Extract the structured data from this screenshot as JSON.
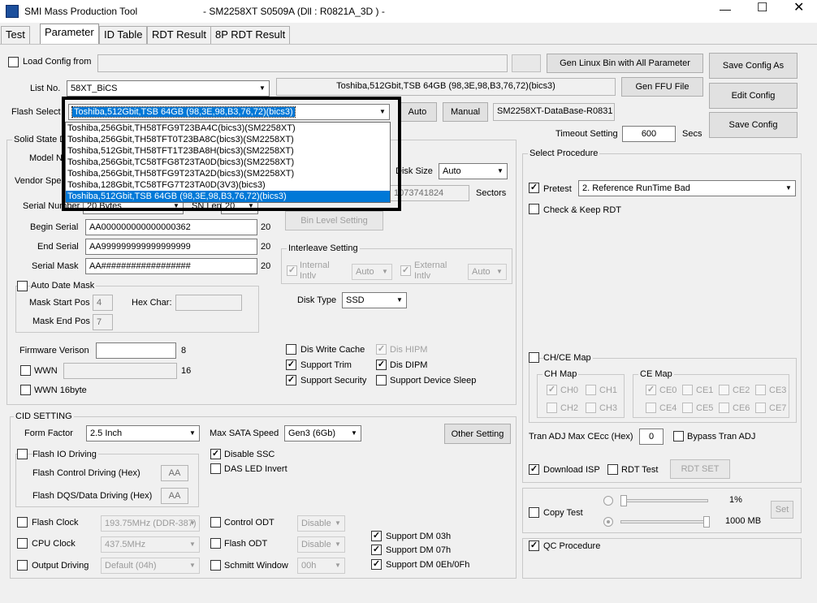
{
  "window": {
    "title": "SMI Mass Production Tool",
    "info": "- SM2258XT   S0509A     (Dll : R0821A_3D ) -"
  },
  "tabs": [
    "Test",
    "Parameter",
    "ID Table",
    "RDT Result",
    "8P RDT Result"
  ],
  "load_config": {
    "label": "Load Config from",
    "browse": "...",
    "value": ""
  },
  "buttons": {
    "gen_linux": "Gen Linux Bin with All Parameter",
    "save_config_as": "Save Config As",
    "gen_ffu": "Gen FFU File",
    "edit_config": "Edit Config",
    "save_config": "Save Config",
    "auto": "Auto",
    "manual": "Manual",
    "bin_level": "Bin Level Setting",
    "other_setting": "Other Setting",
    "rdt_set": "RDT SET",
    "set": "Set"
  },
  "list_no": {
    "label": "List No.",
    "value": "58XT_BiCS",
    "flash_desc": "Toshiba,512Gbit,TSB 64GB (98,3E,98,B3,76,72)(bics3)"
  },
  "flash_select": {
    "label": "Flash Select",
    "value": "Toshiba,512Gbit,TSB 64GB (98,3E,98,B3,76,72)(bics3)",
    "database": "SM2258XT-DataBase-R0831"
  },
  "dropdown_items": [
    "Toshiba,256Gbit,TH58TFG9T23BA4C(bics3)(SM2258XT)",
    "Toshiba,256Gbit,TH58TFT0T23BA8C(bics3)(SM2258XT)",
    "Toshiba,512Gbit,TH58TFT1T23BA8H(bics3)(SM2258XT)",
    "Toshiba,256Gbit,TC58TFG8T23TA0D(bics3)(SM2258XT)",
    "Toshiba,256Gbit,TH58TFG9T23TA2D(bics3)(SM2258XT)",
    "Toshiba,128Gbit,TC58TFG7T23TA0D(3V3)(bics3)",
    "Toshiba,512Gbit,TSB 64GB (98,3E,98,B3,76,72)(bics3)"
  ],
  "timeout": {
    "label": "Timeout Setting",
    "value": "600",
    "unit": "Secs"
  },
  "ssd": {
    "group": "Solid State D",
    "model_label": "Model Na",
    "vendor_label": "Vendor Spec",
    "serial_number_label": "Serial Number",
    "serial_number_value": "20 Bytes",
    "sn_len_label": "SN Len",
    "sn_len_value": "20",
    "disk_size_label": "Disk Size",
    "disk_size_value": "Auto",
    "sectors_value": "1073741824",
    "sectors_label": "Sectors",
    "begin_serial_label": "Begin Serial",
    "begin_serial": "AA000000000000000362",
    "begin_len": "20",
    "end_serial_label": "End Serial",
    "end_serial": "AA999999999999999999",
    "end_len": "20",
    "serial_mask_label": "Serial Mask",
    "serial_mask": "AA##################",
    "mask_len": "20",
    "auto_date_mask": "Auto Date Mask",
    "mask_start_label": "Mask Start Pos",
    "mask_start": "4",
    "hex_char_label": "Hex Char:",
    "mask_end_label": "Mask End Pos",
    "mask_end": "7",
    "interleave": "Interleave Setting",
    "internal_intlv": "Internal Intlv",
    "external_intlv": "External Intlv",
    "auto": "Auto",
    "disk_type_label": "Disk Type",
    "disk_type": "SSD",
    "fw_label": "Firmware Verison",
    "fw_len": "8",
    "wwn": "WWN",
    "wwn_len": "16",
    "wwn16": "WWN 16byte",
    "dis_write_cache": "Dis Write Cache",
    "dis_hipm": "Dis HIPM",
    "support_trim": "Support Trim",
    "dis_dipm": "Dis DIPM",
    "support_security": "Support Security",
    "support_sleep": "Support Device Sleep"
  },
  "cid": {
    "group": "CID SETTING",
    "form_factor_label": "Form Factor",
    "form_factor": "2.5 Inch",
    "max_sata_label": "Max SATA Speed",
    "max_sata": "Gen3 (6Gb)",
    "flash_io": "Flash IO Driving",
    "disable_ssc": "Disable SSC",
    "das_led": "DAS LED Invert",
    "flash_ctrl_label": "Flash Control Driving (Hex)",
    "flash_ctrl": "AA",
    "flash_dqs_label": "Flash DQS/Data Driving (Hex)",
    "flash_dqs": "AA",
    "flash_clock": "Flash Clock",
    "flash_clock_val": "193.75MHz (DDR-387)",
    "control_odt": "Control ODT",
    "control_odt_val": "Disable",
    "cpu_clock": "CPU Clock",
    "cpu_clock_val": "437.5MHz",
    "flash_odt": "Flash ODT",
    "flash_odt_val": "Disable",
    "output_driving": "Output Driving",
    "output_driving_val": "Default (04h)",
    "schmitt": "Schmitt Window",
    "schmitt_val": "00h",
    "dm03": "Support DM 03h",
    "dm07": "Support DM 07h",
    "dm0e": "Support DM 0Eh/0Fh"
  },
  "procedure": {
    "group": "Select Procedure",
    "pretest": "Pretest",
    "pretest_val": "2. Reference RunTime Bad",
    "check_keep": "Check & Keep RDT",
    "chce": "CH/CE Map",
    "ch_map": "CH Map",
    "ce_map": "CE Map",
    "ch": [
      "CH0",
      "CH1",
      "CH2",
      "CH3"
    ],
    "ce": [
      "CE0",
      "CE1",
      "CE2",
      "CE3",
      "CE4",
      "CE5",
      "CE6",
      "CE7"
    ],
    "tran_adj": "Tran ADJ Max CEcc (Hex)",
    "tran_val": "0",
    "bypass": "Bypass Tran ADJ",
    "download_isp": "Download ISP",
    "rdt_test": "RDT Test",
    "copy_test": "Copy Test",
    "pct": "1%",
    "mb": "1000 MB",
    "qc": "QC Procedure"
  }
}
